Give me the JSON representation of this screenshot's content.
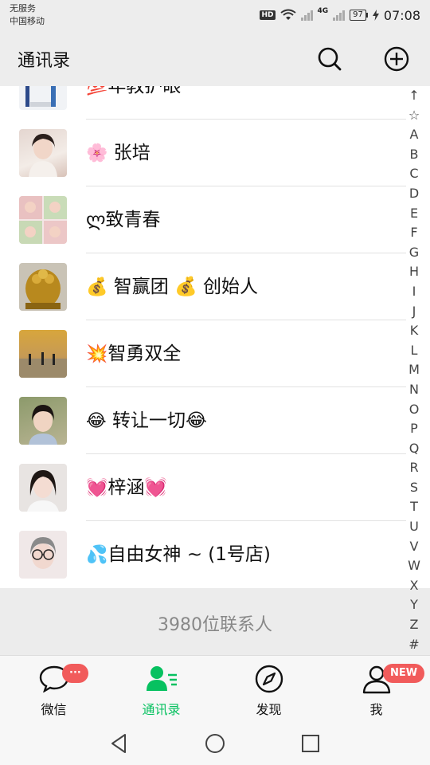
{
  "status_bar": {
    "carrier_line1": "无服务",
    "carrier_line2": "中国移动",
    "hd": "HD",
    "network": "4G",
    "battery": "97",
    "time": "07:08"
  },
  "header": {
    "title": "通讯录",
    "search_icon": "search-icon",
    "add_icon": "plus-circle-icon"
  },
  "contacts": [
    {
      "emoji": "💯",
      "name": "年教护眼"
    },
    {
      "emoji": "🌸",
      "name": " 张培"
    },
    {
      "emoji": "ლ",
      "name": "致青春"
    },
    {
      "emoji": "💰",
      "name": " 智赢团 💰 创始人"
    },
    {
      "emoji": "💥",
      "name": "智勇双全"
    },
    {
      "emoji": "😂",
      "name": " 转让一切😂"
    },
    {
      "emoji": "💓",
      "name": "梓涵💓"
    },
    {
      "emoji": "💦",
      "name": "自由女神 ~ (1号店)"
    }
  ],
  "contact_count": "3980位联系人",
  "index_letters": [
    "↑",
    "☆",
    "A",
    "B",
    "C",
    "D",
    "E",
    "F",
    "G",
    "H",
    "I",
    "J",
    "K",
    "L",
    "M",
    "N",
    "O",
    "P",
    "Q",
    "R",
    "S",
    "T",
    "U",
    "V",
    "W",
    "X",
    "Y",
    "Z",
    "#"
  ],
  "tabs": [
    {
      "label": "微信",
      "icon": "chat-icon",
      "badge": "···"
    },
    {
      "label": "通讯录",
      "icon": "contacts-icon",
      "badge": ""
    },
    {
      "label": "发现",
      "icon": "compass-icon",
      "badge": ""
    },
    {
      "label": "我",
      "icon": "person-icon",
      "badge": "NEW"
    }
  ],
  "colors": {
    "accent": "#07c160",
    "badge": "#f15b5b",
    "header_bg": "#ededed"
  }
}
